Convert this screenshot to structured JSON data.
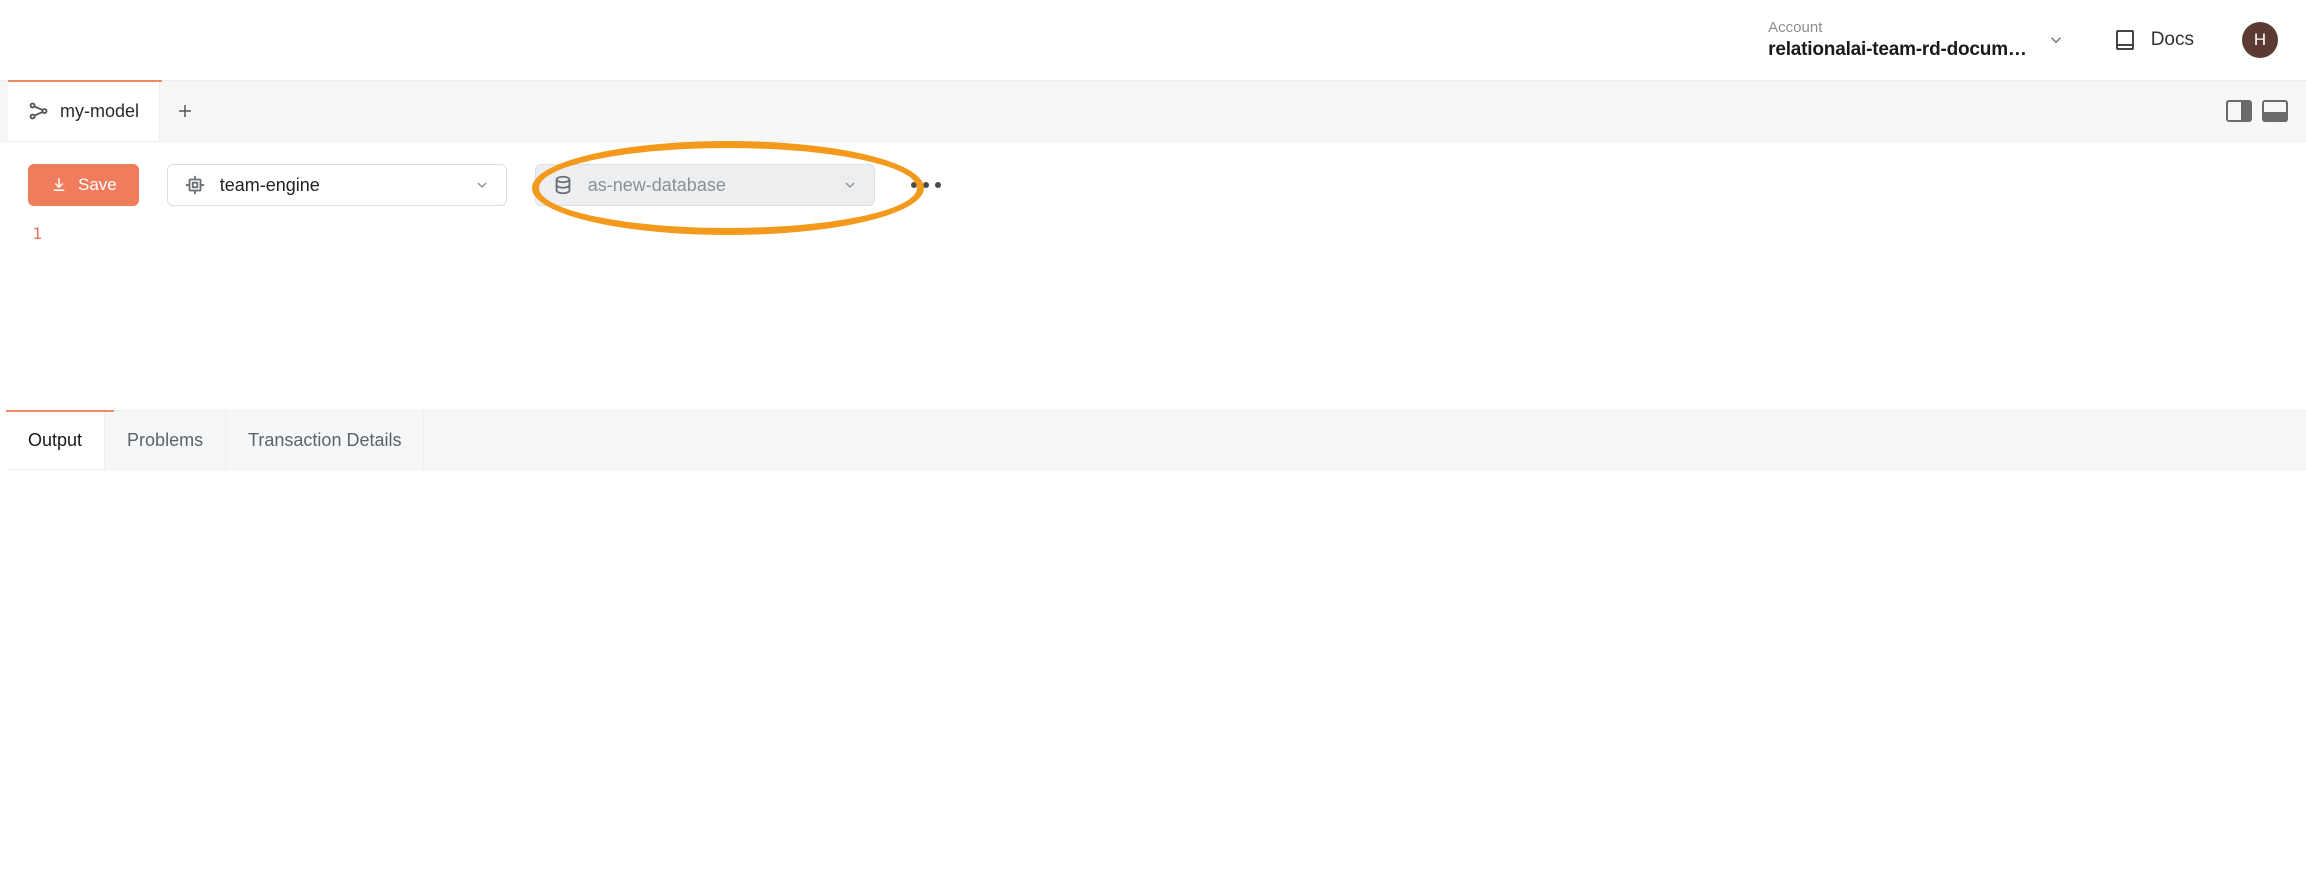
{
  "header": {
    "account_label": "Account",
    "account_name": "relationalai-team-rd-docum…",
    "docs_label": "Docs",
    "avatar_initial": "H"
  },
  "tabs": {
    "items": [
      {
        "label": "my-model",
        "active": true
      }
    ]
  },
  "toolbar": {
    "save_label": "Save",
    "engine_select": {
      "value": "team-engine"
    },
    "database_select": {
      "placeholder": "as-new-database"
    }
  },
  "editor": {
    "line_numbers": [
      "1"
    ]
  },
  "bottom_tabs": {
    "items": [
      {
        "label": "Output",
        "active": true
      },
      {
        "label": "Problems",
        "active": false
      },
      {
        "label": "Transaction Details",
        "active": false
      }
    ]
  }
}
